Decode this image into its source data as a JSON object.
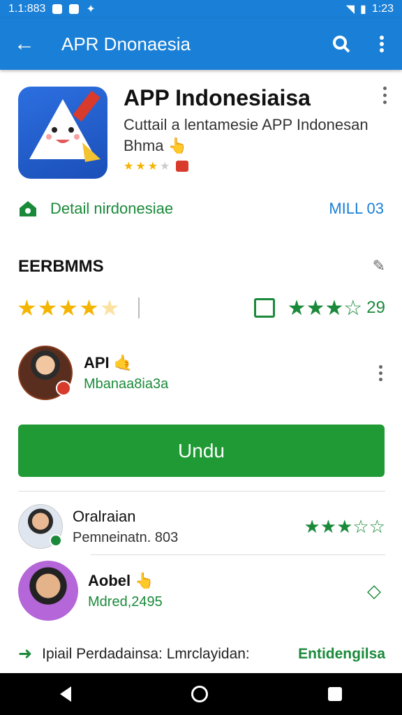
{
  "status_bar": {
    "time_left": "1.1:883",
    "time_right": "1:23"
  },
  "app_bar": {
    "title": "APR Dnonaesia",
    "back_icon": "arrow-left-icon",
    "search_icon": "search-icon",
    "more_icon": "more-vert-icon"
  },
  "app": {
    "title": "APP Indonesiaisa",
    "subtitle_line1": "Cuttail a lentamesie APP Indonesan",
    "subtitle_line2": "Bhma",
    "rating_small": 3,
    "colors": {
      "icon_bg": "#2c6fe0",
      "accent": "#f4b400"
    }
  },
  "detail": {
    "label": "Detail nirdonesiae",
    "right_text": "MILL 03"
  },
  "section": {
    "title": "EERBMMS"
  },
  "rating": {
    "stars": 4.5,
    "review_stars": 4,
    "count": "29"
  },
  "developer": {
    "name": "API",
    "subtitle": "Mbanaa8ia3a"
  },
  "install": {
    "label": "Undu"
  },
  "users": [
    {
      "name": "Oralraian",
      "subtitle": "Pemneinatn. 803",
      "stars": 3.5
    },
    {
      "name": "Aobel",
      "subtitle": "Mdred,2495"
    }
  ],
  "footer": {
    "text": "Ipiail Perdadainsa: Lmrclayidan:",
    "link": "Entidengilsa"
  },
  "nav": {
    "back_icon": "back-triangle-icon",
    "home_icon": "home-circle-icon",
    "recent_icon": "recent-square-icon"
  }
}
